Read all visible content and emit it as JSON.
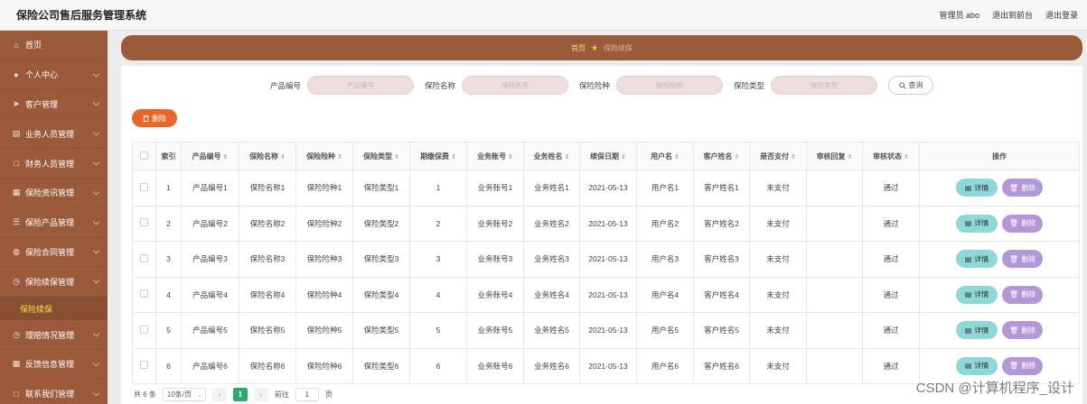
{
  "app": {
    "title": "保险公司售后服务管理系统"
  },
  "topbar": {
    "user": "管理员 abo",
    "front": "退出到前台",
    "logout": "退出登录"
  },
  "sidebar": {
    "items": [
      {
        "label": "首页",
        "icon": "home-icon"
      },
      {
        "label": "个人中心",
        "icon": "user-icon"
      },
      {
        "label": "客户管理",
        "icon": "send-icon"
      },
      {
        "label": "业务人员管理",
        "icon": "bank-icon"
      },
      {
        "label": "财务人员管理",
        "icon": "square-icon"
      },
      {
        "label": "保险资讯管理",
        "icon": "grid-icon"
      },
      {
        "label": "保险产品管理",
        "icon": "list-icon"
      },
      {
        "label": "保险合同管理",
        "icon": "bulb-icon"
      },
      {
        "label": "保险续保管理",
        "icon": "clock-icon"
      }
    ],
    "sub_active": "保险续保",
    "items_after": [
      {
        "label": "理赔情况管理",
        "icon": "clock-icon"
      },
      {
        "label": "反馈信息管理",
        "icon": "grid-icon"
      },
      {
        "label": "联系我们管理",
        "icon": "square-icon"
      }
    ]
  },
  "breadcrumb": {
    "home": "首页",
    "current": "保险续保"
  },
  "search": {
    "f1_label": "产品编号",
    "f1_ph": "产品编号",
    "f2_label": "保险名称",
    "f2_ph": "保险名称",
    "f3_label": "保险险种",
    "f3_ph": "保险险种",
    "f4_label": "保险类型",
    "f4_ph": "保险类型",
    "button": "查询"
  },
  "toolbar": {
    "delete": "删除"
  },
  "table": {
    "headers": [
      "",
      "索引",
      "产品编号",
      "保险名称",
      "保险险种",
      "保险类型",
      "期缴保费",
      "业务账号",
      "业务姓名",
      "续保日期",
      "用户名",
      "客户姓名",
      "是否支付",
      "审核回复",
      "审核状态",
      "操作"
    ],
    "sortable": [
      false,
      false,
      true,
      true,
      true,
      true,
      true,
      true,
      true,
      true,
      true,
      true,
      true,
      true,
      true,
      false
    ],
    "rows": [
      [
        "1",
        "产品编号1",
        "保险名称1",
        "保险险种1",
        "保险类型1",
        "1",
        "业务账号1",
        "业务姓名1",
        "2021-05-13",
        "用户名1",
        "客户姓名1",
        "未支付",
        "",
        "通过"
      ],
      [
        "2",
        "产品编号2",
        "保险名称2",
        "保险险种2",
        "保险类型2",
        "2",
        "业务账号2",
        "业务姓名2",
        "2021-05-13",
        "用户名2",
        "客户姓名2",
        "未支付",
        "",
        "通过"
      ],
      [
        "3",
        "产品编号3",
        "保险名称3",
        "保险险种3",
        "保险类型3",
        "3",
        "业务账号3",
        "业务姓名3",
        "2021-05-13",
        "用户名3",
        "客户姓名3",
        "未支付",
        "",
        "通过"
      ],
      [
        "4",
        "产品编号4",
        "保险名称4",
        "保险险种4",
        "保险类型4",
        "4",
        "业务账号4",
        "业务姓名4",
        "2021-05-13",
        "用户名4",
        "客户姓名4",
        "未支付",
        "",
        "通过"
      ],
      [
        "5",
        "产品编号5",
        "保险名称5",
        "保险险种5",
        "保险类型5",
        "5",
        "业务账号5",
        "业务姓名5",
        "2021-05-13",
        "用户名5",
        "客户姓名5",
        "未支付",
        "",
        "通过"
      ],
      [
        "6",
        "产品编号6",
        "保险名称6",
        "保险险种6",
        "保险类型6",
        "6",
        "业务账号6",
        "业务姓名6",
        "2021-05-13",
        "用户名6",
        "客户姓名6",
        "未支付",
        "",
        "通过"
      ]
    ],
    "detail_label": "详情",
    "delete_label": "删除"
  },
  "pager": {
    "total": "共 6 条",
    "page_size": "10条/页",
    "current": "1",
    "goto": "前往",
    "goto_value": "1",
    "page_unit": "页"
  },
  "watermark": "CSDN @计算机程序_设计",
  "colors": {
    "sidebar": "#9b5b3b",
    "delete": "#e8682c",
    "detail": "#8fd8d8",
    "row_delete": "#b397d6",
    "pager_current": "#2da86a"
  }
}
